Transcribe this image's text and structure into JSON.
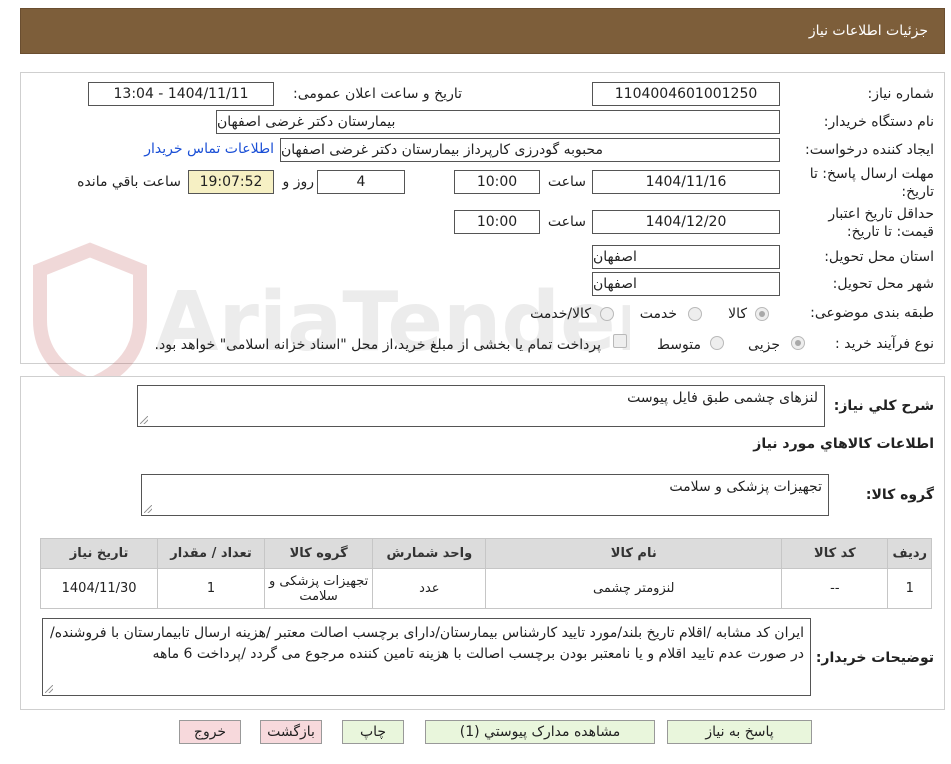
{
  "header": {
    "title": "جزئیات اطلاعات نیاز"
  },
  "form": {
    "need_number_label": "شماره نیاز:",
    "need_number": "1104004601001250",
    "announce_label": "تاریخ و ساعت اعلان عمومی:",
    "announce_value": "1404/11/11 - 13:04",
    "buyer_org_label": "نام دستگاه خریدار:",
    "buyer_org": "بیمارستان دکتر غرضی اصفهان",
    "creator_label": "ایجاد کننده درخواست:",
    "creator": "محبوبه گودرزی کارپرداز بیمارستان دکتر غرضی اصفهان",
    "contact_link": "اطلاعات تماس خریدار",
    "deadline_label_1": "مهلت ارسال پاسخ: تا",
    "deadline_label_2": "تاریخ:",
    "deadline_date": "1404/11/16",
    "time_label": "ساعت",
    "deadline_time": "10:00",
    "days_value": "4",
    "days_label": "روز و",
    "remaining_time": "19:07:52",
    "remaining_label": "ساعت باقي مانده",
    "validity_label_1": "حداقل تاریخ اعتبار",
    "validity_label_2": "قیمت: تا تاریخ:",
    "validity_date": "1404/12/20",
    "validity_time": "10:00",
    "province_label": "استان محل تحویل:",
    "province": "اصفهان",
    "city_label": "شهر محل تحویل:",
    "city": "اصفهان",
    "category_label": "طبقه بندی موضوعی:",
    "category_options": [
      "کالا",
      "خدمت",
      "کالا/خدمت"
    ],
    "process_label": "نوع فرآیند خرید :",
    "process_options": [
      "جزیی",
      "متوسط"
    ],
    "treasury_note": "پرداخت تمام یا بخشی از مبلغ خرید،از محل \"اسناد خزانه اسلامی\" خواهد بود."
  },
  "description": {
    "summary_label": "شرح کلي نياز:",
    "summary": "لنزهای چشمی طبق فایل پیوست",
    "items_heading": "اطلاعات کالاهاي مورد نياز",
    "group_label": "گروه کالا:",
    "group_value": "تجهیزات پزشکی و سلامت",
    "table": {
      "headers": [
        "رديف",
        "کد کالا",
        "نام کالا",
        "واحد شمارش",
        "گروه کالا",
        "تعداد / مقدار",
        "تاريخ نياز"
      ],
      "rows": [
        [
          "1",
          "--",
          "لنزومتر چشمی",
          "عدد",
          "تجهیزات پزشکی و سلامت",
          "1",
          "1404/11/30"
        ]
      ]
    },
    "buyer_notes_label": "توضیحات خریدار:",
    "buyer_notes": "ایران کد مشابه /اقلام تاریخ بلند/مورد تایید کارشناس بیمارستان/دارای برچسب اصالت معتبر /هزینه ارسال تابیمارستان با فروشنده/در صورت عدم تایید اقلام و یا نامعتبر بودن برچسب اصالت با هزینه تامین کننده مرجوع می گردد /پرداخت 6 ماهه"
  },
  "buttons": {
    "reply": "پاسخ به نياز",
    "attachments": "مشاهده مدارک پيوستي (1)",
    "print": "چاپ",
    "back": "بازگشت",
    "exit": "خروج"
  },
  "watermark": {
    "text": "AriaTender.neT"
  },
  "colors": {
    "header_bg": "#7d5e3a",
    "link": "#1a4fd6",
    "remaining_bg": "#f6f0c4",
    "button_green": "#e9f6dc",
    "button_red": "#f7d9dc"
  }
}
